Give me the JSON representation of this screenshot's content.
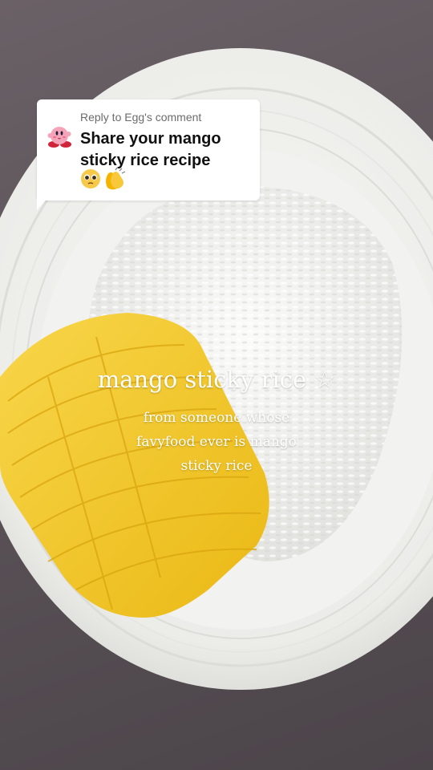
{
  "reply_card": {
    "label": "Reply to Egg's comment",
    "text": "Share your mango sticky rice recipe",
    "avatar_icon": "kirby-avatar-icon",
    "emoji_icons": [
      "pleading-face-emoji-icon",
      "clapping-hands-emoji-icon"
    ]
  },
  "overlay": {
    "title": "mango sticky rice",
    "title_icon": "star-outline-icon",
    "title_star": "☆",
    "subtitle_lines": [
      "from someone whose",
      "favyfood ever is mango",
      "sticky rice"
    ]
  },
  "colors": {
    "background": "#5a5257",
    "plate": "#f1f1ef",
    "mango": "#f3c51f",
    "rice": "#f7f7f5",
    "bubble": "#ffffff"
  }
}
